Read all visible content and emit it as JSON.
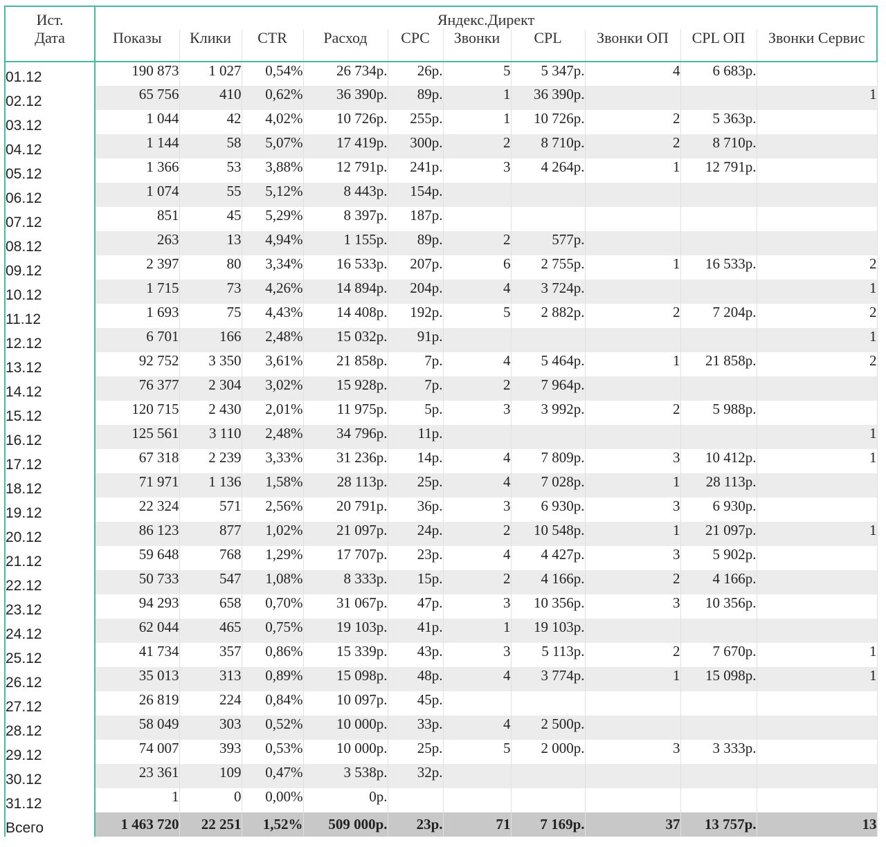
{
  "header": {
    "corner_top": "Ист.",
    "corner_bottom": "Дата",
    "source": "Яндекс.Директ",
    "columns": [
      "Показы",
      "Клики",
      "CTR",
      "Расход",
      "CPC",
      "Звонки",
      "CPL",
      "Звонки ОП",
      "CPL ОП",
      "Звонки Сервис"
    ]
  },
  "rows": [
    [
      "01.12",
      "190 873",
      "1 027",
      "0,54%",
      "26 734р.",
      "26р.",
      "5",
      "5 347р.",
      "4",
      "6 683р.",
      ""
    ],
    [
      "02.12",
      "65 756",
      "410",
      "0,62%",
      "36 390р.",
      "89р.",
      "1",
      "36 390р.",
      "",
      "",
      "1"
    ],
    [
      "03.12",
      "1 044",
      "42",
      "4,02%",
      "10 726р.",
      "255р.",
      "1",
      "10 726р.",
      "2",
      "5 363р.",
      ""
    ],
    [
      "04.12",
      "1 144",
      "58",
      "5,07%",
      "17 419р.",
      "300р.",
      "2",
      "8 710р.",
      "2",
      "8 710р.",
      ""
    ],
    [
      "05.12",
      "1 366",
      "53",
      "3,88%",
      "12 791р.",
      "241р.",
      "3",
      "4 264р.",
      "1",
      "12 791р.",
      ""
    ],
    [
      "06.12",
      "1 074",
      "55",
      "5,12%",
      "8 443р.",
      "154р.",
      "",
      "",
      "",
      "",
      ""
    ],
    [
      "07.12",
      "851",
      "45",
      "5,29%",
      "8 397р.",
      "187р.",
      "",
      "",
      "",
      "",
      ""
    ],
    [
      "08.12",
      "263",
      "13",
      "4,94%",
      "1 155р.",
      "89р.",
      "2",
      "577р.",
      "",
      "",
      ""
    ],
    [
      "09.12",
      "2 397",
      "80",
      "3,34%",
      "16 533р.",
      "207р.",
      "6",
      "2 755р.",
      "1",
      "16 533р.",
      "2"
    ],
    [
      "10.12",
      "1 715",
      "73",
      "4,26%",
      "14 894р.",
      "204р.",
      "4",
      "3 724р.",
      "",
      "",
      "1"
    ],
    [
      "11.12",
      "1 693",
      "75",
      "4,43%",
      "14 408р.",
      "192р.",
      "5",
      "2 882р.",
      "2",
      "7 204р.",
      "2"
    ],
    [
      "12.12",
      "6 701",
      "166",
      "2,48%",
      "15 032р.",
      "91р.",
      "",
      "",
      "",
      "",
      "1"
    ],
    [
      "13.12",
      "92 752",
      "3 350",
      "3,61%",
      "21 858р.",
      "7р.",
      "4",
      "5 464р.",
      "1",
      "21 858р.",
      "2"
    ],
    [
      "14.12",
      "76 377",
      "2 304",
      "3,02%",
      "15 928р.",
      "7р.",
      "2",
      "7 964р.",
      "",
      "",
      ""
    ],
    [
      "15.12",
      "120 715",
      "2 430",
      "2,01%",
      "11 975р.",
      "5р.",
      "3",
      "3 992р.",
      "2",
      "5 988р.",
      ""
    ],
    [
      "16.12",
      "125 561",
      "3 110",
      "2,48%",
      "34 796р.",
      "11р.",
      "",
      "",
      "",
      "",
      "1"
    ],
    [
      "17.12",
      "67 318",
      "2 239",
      "3,33%",
      "31 236р.",
      "14р.",
      "4",
      "7 809р.",
      "3",
      "10 412р.",
      "1"
    ],
    [
      "18.12",
      "71 971",
      "1 136",
      "1,58%",
      "28 113р.",
      "25р.",
      "4",
      "7 028р.",
      "1",
      "28 113р.",
      ""
    ],
    [
      "19.12",
      "22 324",
      "571",
      "2,56%",
      "20 791р.",
      "36р.",
      "3",
      "6 930р.",
      "3",
      "6 930р.",
      ""
    ],
    [
      "20.12",
      "86 123",
      "877",
      "1,02%",
      "21 097р.",
      "24р.",
      "2",
      "10 548р.",
      "1",
      "21 097р.",
      "1"
    ],
    [
      "21.12",
      "59 648",
      "768",
      "1,29%",
      "17 707р.",
      "23р.",
      "4",
      "4 427р.",
      "3",
      "5 902р.",
      ""
    ],
    [
      "22.12",
      "50 733",
      "547",
      "1,08%",
      "8 333р.",
      "15р.",
      "2",
      "4 166р.",
      "2",
      "4 166р.",
      ""
    ],
    [
      "23.12",
      "94 293",
      "658",
      "0,70%",
      "31 067р.",
      "47р.",
      "3",
      "10 356р.",
      "3",
      "10 356р.",
      ""
    ],
    [
      "24.12",
      "62 044",
      "465",
      "0,75%",
      "19 103р.",
      "41р.",
      "1",
      "19 103р.",
      "",
      "",
      ""
    ],
    [
      "25.12",
      "41 734",
      "357",
      "0,86%",
      "15 339р.",
      "43р.",
      "3",
      "5 113р.",
      "2",
      "7 670р.",
      "1"
    ],
    [
      "26.12",
      "35 013",
      "313",
      "0,89%",
      "15 098р.",
      "48р.",
      "4",
      "3 774р.",
      "1",
      "15 098р.",
      "1"
    ],
    [
      "27.12",
      "26 819",
      "224",
      "0,84%",
      "10 097р.",
      "45р.",
      "",
      "",
      "",
      "",
      ""
    ],
    [
      "28.12",
      "58 049",
      "303",
      "0,52%",
      "10 000р.",
      "33р.",
      "4",
      "2 500р.",
      "",
      "",
      ""
    ],
    [
      "29.12",
      "74 007",
      "393",
      "0,53%",
      "10 000р.",
      "25р.",
      "5",
      "2 000р.",
      "3",
      "3 333р.",
      ""
    ],
    [
      "30.12",
      "23 361",
      "109",
      "0,47%",
      "3 538р.",
      "32р.",
      "",
      "",
      "",
      "",
      ""
    ],
    [
      "31.12",
      "1",
      "0",
      "0,00%",
      "0р.",
      "",
      "",
      "",
      "",
      "",
      ""
    ]
  ],
  "total": [
    "Всего",
    "1 463 720",
    "22 251",
    "1,52%",
    "509 000р.",
    "23р.",
    "71",
    "7 169р.",
    "37",
    "13 757р.",
    "13"
  ]
}
